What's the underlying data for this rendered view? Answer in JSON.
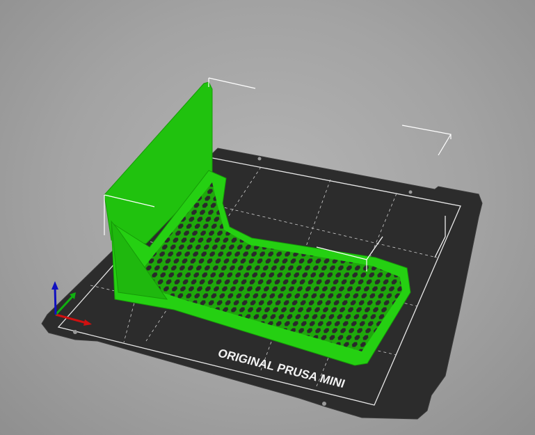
{
  "scene": {
    "bed_label": "ORIGINAL PRUSA MINI",
    "model_color": "#22c90f",
    "bed_color": "#2b2b2b",
    "axis_colors": {
      "x": "#d01010",
      "y": "#10b010",
      "z": "#1010c0"
    }
  }
}
